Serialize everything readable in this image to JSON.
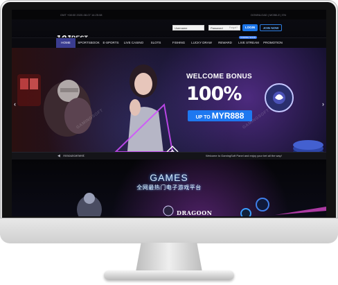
{
  "topbar": {
    "datetime": "GMT +08:00 2020-08-07 14:25:08",
    "links": "DOWNLOAD | MOBILE | EN"
  },
  "logo": {
    "number": "101",
    "word": "BEST",
    "sub": "WHITE LABEL"
  },
  "login": {
    "username_placeholder": "Username",
    "password_placeholder": "Password",
    "forgot_label": "Forgot?",
    "login_label": "LOGIN",
    "join_label": "JOIN NOW"
  },
  "nav": {
    "items": [
      {
        "label": "HOME"
      },
      {
        "label": "SPORTSBOOK"
      },
      {
        "label": "E-SPORTS"
      },
      {
        "label": "LIVE CASINO"
      },
      {
        "label": "SLOTS"
      },
      {
        "label": "FISHING"
      },
      {
        "label": "LUCKY DRAW"
      },
      {
        "label": "REWARD"
      },
      {
        "label": "LIVE STREAM"
      },
      {
        "label": "PROMOTION"
      }
    ],
    "badge_label": "COMING SOON"
  },
  "hero": {
    "bonus_title": "WELCOME BONUS",
    "bonus_percent": "100%",
    "bonus_cap_prefix": "UP TO ",
    "bonus_cap_amount": "MYR888",
    "watermark": "GAMINGSOFT"
  },
  "announcement": {
    "label": "Announcement:",
    "text": "Welcome to GamingSoft Panel and enjoy your bet all the way!"
  },
  "games": {
    "title": "GAMES",
    "subtitle": "全网最热门电子游戏平台",
    "provider_logo_text": "DRAGOON"
  },
  "colors": {
    "accent_blue": "#1e78f0",
    "nav_active": "#3a3c8f",
    "hero_purple": "#7d3ec4"
  }
}
